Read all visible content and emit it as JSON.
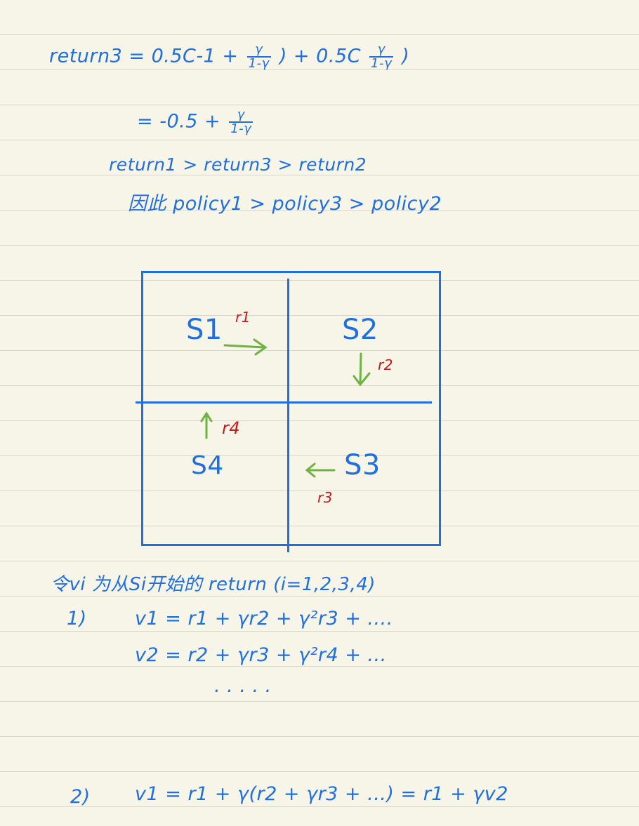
{
  "lines": {
    "l1_a": "return3 = 0.5C-1 +",
    "l1_f1_num": "γ",
    "l1_f1_den": "1-γ",
    "l1_b": ") + 0.5C",
    "l1_f2_num": "γ",
    "l1_f2_den": "1-γ",
    "l1_c": ")",
    "l2_a": "= -0.5 +",
    "l2_f_num": "γ",
    "l2_f_den": "1-γ",
    "l3": "return1 > return3 > return2",
    "l4": "因此 policy1 > policy3 > policy2"
  },
  "diagram": {
    "states": [
      "S1",
      "S2",
      "S3",
      "S4"
    ],
    "rewards": [
      "r1",
      "r2",
      "r3",
      "r4"
    ]
  },
  "notes": {
    "n1": "令vi 为从Si开始的 return (i=1,2,3,4)",
    "n2_num": "1)",
    "n2_eq1": "v1 = r1 + γr2 + γ²r3 + ....",
    "n2_eq2": "v2 = r2 + γr3 + γ²r4 + ...",
    "n2_dots": ". . . . .",
    "n3_num": "2)",
    "n3_eq": "v1 = r1 + γ(r2 + γr3 + ...) = r1 + γv2"
  },
  "colors": {
    "ink_blue": "#1f6fe0",
    "ink_red": "#c61a1a",
    "ink_green": "#6db33f",
    "paper": "#f7f4e8",
    "rule": "#d9d7cf"
  }
}
